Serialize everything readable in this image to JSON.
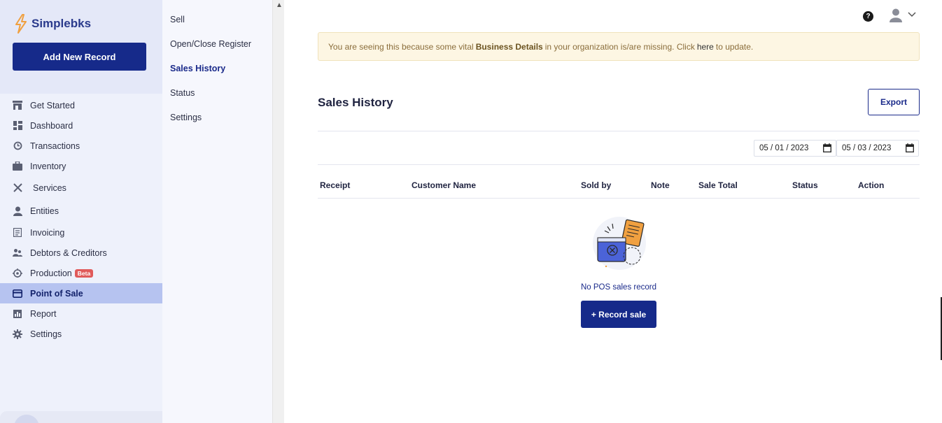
{
  "brand": {
    "name": "Simplebks",
    "accent": "#162a8a",
    "logo_color": "#f0a040"
  },
  "sidebar": {
    "add_button": "Add New Record",
    "items": [
      {
        "label": "Get Started",
        "icon": "store-icon"
      },
      {
        "label": "Dashboard",
        "icon": "dashboard-icon"
      },
      {
        "label": "Transactions",
        "icon": "history-icon"
      },
      {
        "label": "Inventory",
        "icon": "briefcase-icon"
      },
      {
        "label": "Services",
        "icon": "tools-icon"
      },
      {
        "label": "Entities",
        "icon": "person-icon"
      },
      {
        "label": "Invoicing",
        "icon": "invoice-icon"
      },
      {
        "label": "Debtors & Creditors",
        "icon": "people-icon"
      },
      {
        "label": "Production",
        "icon": "factory-icon",
        "badge": "Beta"
      },
      {
        "label": "Point of Sale",
        "icon": "card-icon",
        "active": true
      },
      {
        "label": "Report",
        "icon": "chart-icon"
      },
      {
        "label": "Settings",
        "icon": "gear-icon"
      }
    ]
  },
  "submenu": {
    "items": [
      {
        "label": "Sell"
      },
      {
        "label": "Open/Close Register"
      },
      {
        "label": "Sales History",
        "active": true
      },
      {
        "label": "Status"
      },
      {
        "label": "Settings"
      }
    ]
  },
  "alert": {
    "prefix": "You are seeing this because some vital",
    "bold": "Business Details",
    "middle": "in your organization is/are missing. Click",
    "link": "here",
    "suffix": "to update."
  },
  "header": {
    "help": "?"
  },
  "main": {
    "title": "Sales History",
    "export_label": "Export",
    "date_from": "05 / 01 / 2023",
    "date_to": "05 / 03 / 2023",
    "columns": [
      "Receipt",
      "Customer Name",
      "Sold by",
      "Note",
      "Sale Total",
      "Status",
      "Action"
    ],
    "empty_text": "No POS sales record",
    "record_button": "+ Record sale"
  }
}
